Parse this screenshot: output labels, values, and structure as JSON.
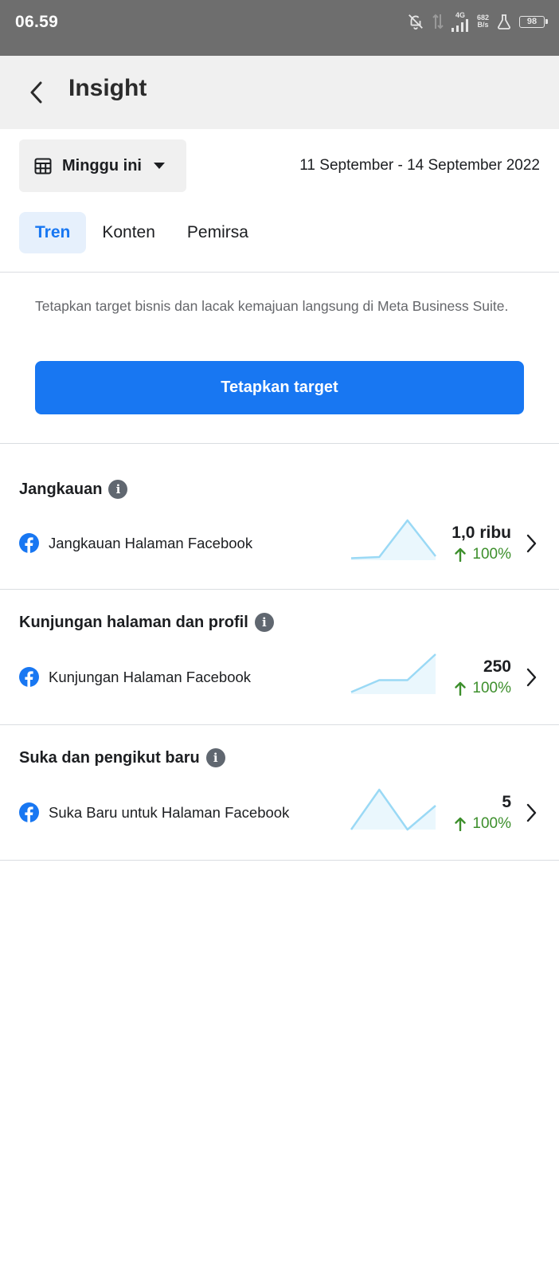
{
  "status_bar": {
    "time": "06.59",
    "network_type": "4G",
    "net_speed_value": "682",
    "net_speed_unit": "B/s",
    "battery_level": "98"
  },
  "header": {
    "title": "Insight",
    "back_icon": "chevron-left-icon"
  },
  "filters": {
    "date_preset": "Minggu ini",
    "date_range": "11 September - 14 September 2022"
  },
  "tabs": [
    {
      "label": "Tren",
      "active": true
    },
    {
      "label": "Konten",
      "active": false
    },
    {
      "label": "Pemirsa",
      "active": false
    }
  ],
  "promo": {
    "text": "Tetapkan target bisnis dan lacak kemajuan langsung di Meta Business Suite.",
    "button_label": "Tetapkan target"
  },
  "sections": [
    {
      "title": "Jangkauan",
      "metric_label": "Jangkauan Halaman Facebook",
      "value": "1,0 ribu",
      "change": "100%",
      "trend": "up",
      "sparkline": [
        0.05,
        0.08,
        1.0,
        0.1
      ]
    },
    {
      "title": "Kunjungan halaman dan profil",
      "metric_label": "Kunjungan Halaman Facebook",
      "value": "250",
      "change": "100%",
      "trend": "up",
      "sparkline": [
        0.05,
        0.35,
        0.35,
        1.0
      ]
    },
    {
      "title": "Suka dan pengikut baru",
      "metric_label": "Suka Baru untuk Halaman Facebook",
      "value": "5",
      "change": "100%",
      "trend": "up",
      "sparkline": [
        0.0,
        1.0,
        0.0,
        0.6
      ]
    }
  ],
  "colors": {
    "accent": "#1877f2",
    "positive": "#3d8f2c",
    "sparkline_stroke": "#9ad9f5",
    "sparkline_fill": "#eaf7fd"
  }
}
